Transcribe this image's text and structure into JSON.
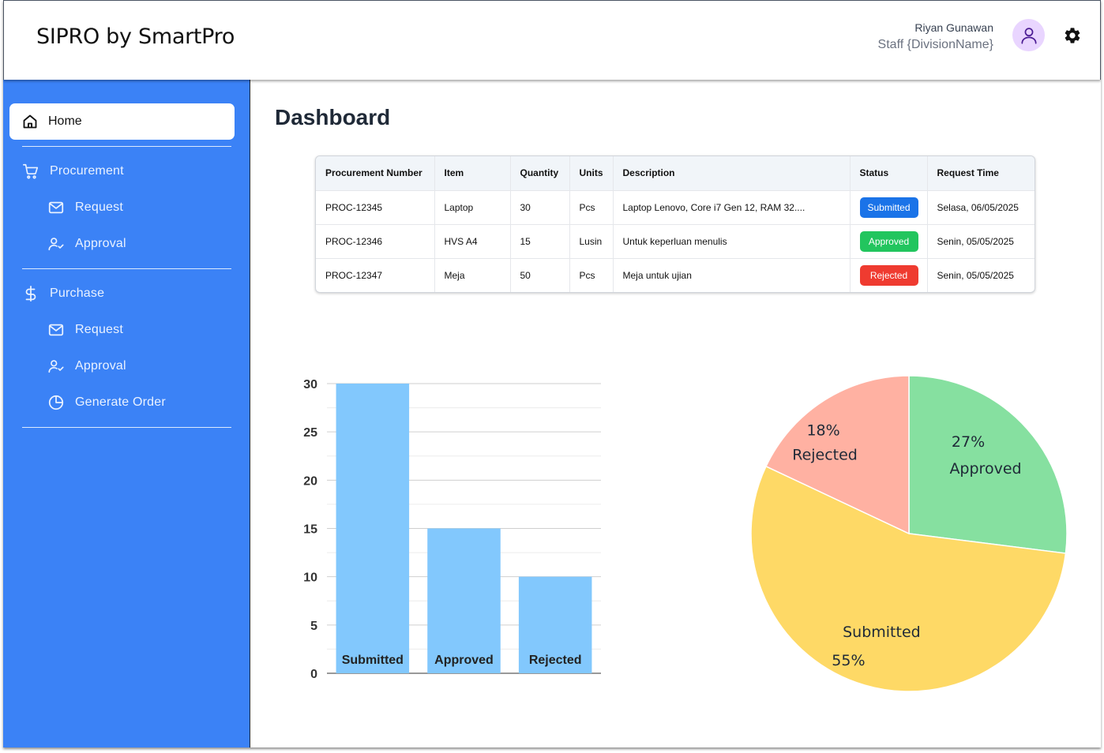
{
  "app": {
    "title": "SIPRO by SmartPro"
  },
  "user": {
    "name": "Riyan Gunawan",
    "role": "Staff {DivisionName}"
  },
  "sidebar": {
    "home": "Home",
    "procurement": {
      "label": "Procurement",
      "request": "Request",
      "approval": "Approval"
    },
    "purchase": {
      "label": "Purchase",
      "request": "Request",
      "approval": "Approval",
      "generate_order": "Generate Order"
    }
  },
  "page": {
    "title": "Dashboard"
  },
  "table": {
    "headers": [
      "Procurement Number",
      "Item",
      "Quantity",
      "Units",
      "Description",
      "Status",
      "Request Time"
    ],
    "rows": [
      {
        "number": "PROC-12345",
        "item": "Laptop",
        "quantity": "30",
        "units": "Pcs",
        "description": "Laptop Lenovo, Core i7 Gen 12, RAM 32....",
        "status": "Submitted",
        "time": "Selasa, 06/05/2025"
      },
      {
        "number": "PROC-12346",
        "item": "HVS A4",
        "quantity": "15",
        "units": "Lusin",
        "description": "Untuk keperluan menulis",
        "status": "Approved",
        "time": "Senin, 05/05/2025"
      },
      {
        "number": "PROC-12347",
        "item": "Meja",
        "quantity": "50",
        "units": "Pcs",
        "description": "Meja untuk ujian",
        "status": "Rejected",
        "time": "Senin, 05/05/2025"
      }
    ]
  },
  "colors": {
    "sidebar": "#3b82f6",
    "submitted_badge": "#1a73e8",
    "approved_badge": "#22c55e",
    "rejected_badge": "#ef3b30",
    "bar": "#82c8fd",
    "pie_approved": "#86e0a0",
    "pie_submitted": "#fed966",
    "pie_rejected": "#ffb1a2"
  },
  "chart_data": [
    {
      "type": "bar",
      "categories": [
        "Submitted",
        "Approved",
        "Rejected"
      ],
      "values": [
        30,
        15,
        10
      ],
      "ylim": [
        0,
        30
      ],
      "yticks": [
        0,
        5,
        10,
        15,
        20,
        25,
        30
      ],
      "grid": true,
      "title": "",
      "xlabel": "",
      "ylabel": ""
    },
    {
      "type": "pie",
      "slices": [
        {
          "label": "Approved",
          "value": 27,
          "pct": "27%"
        },
        {
          "label": "Submitted",
          "value": 55,
          "pct": "55%"
        },
        {
          "label": "Rejected",
          "value": 18,
          "pct": "18%"
        }
      ],
      "title": ""
    }
  ]
}
